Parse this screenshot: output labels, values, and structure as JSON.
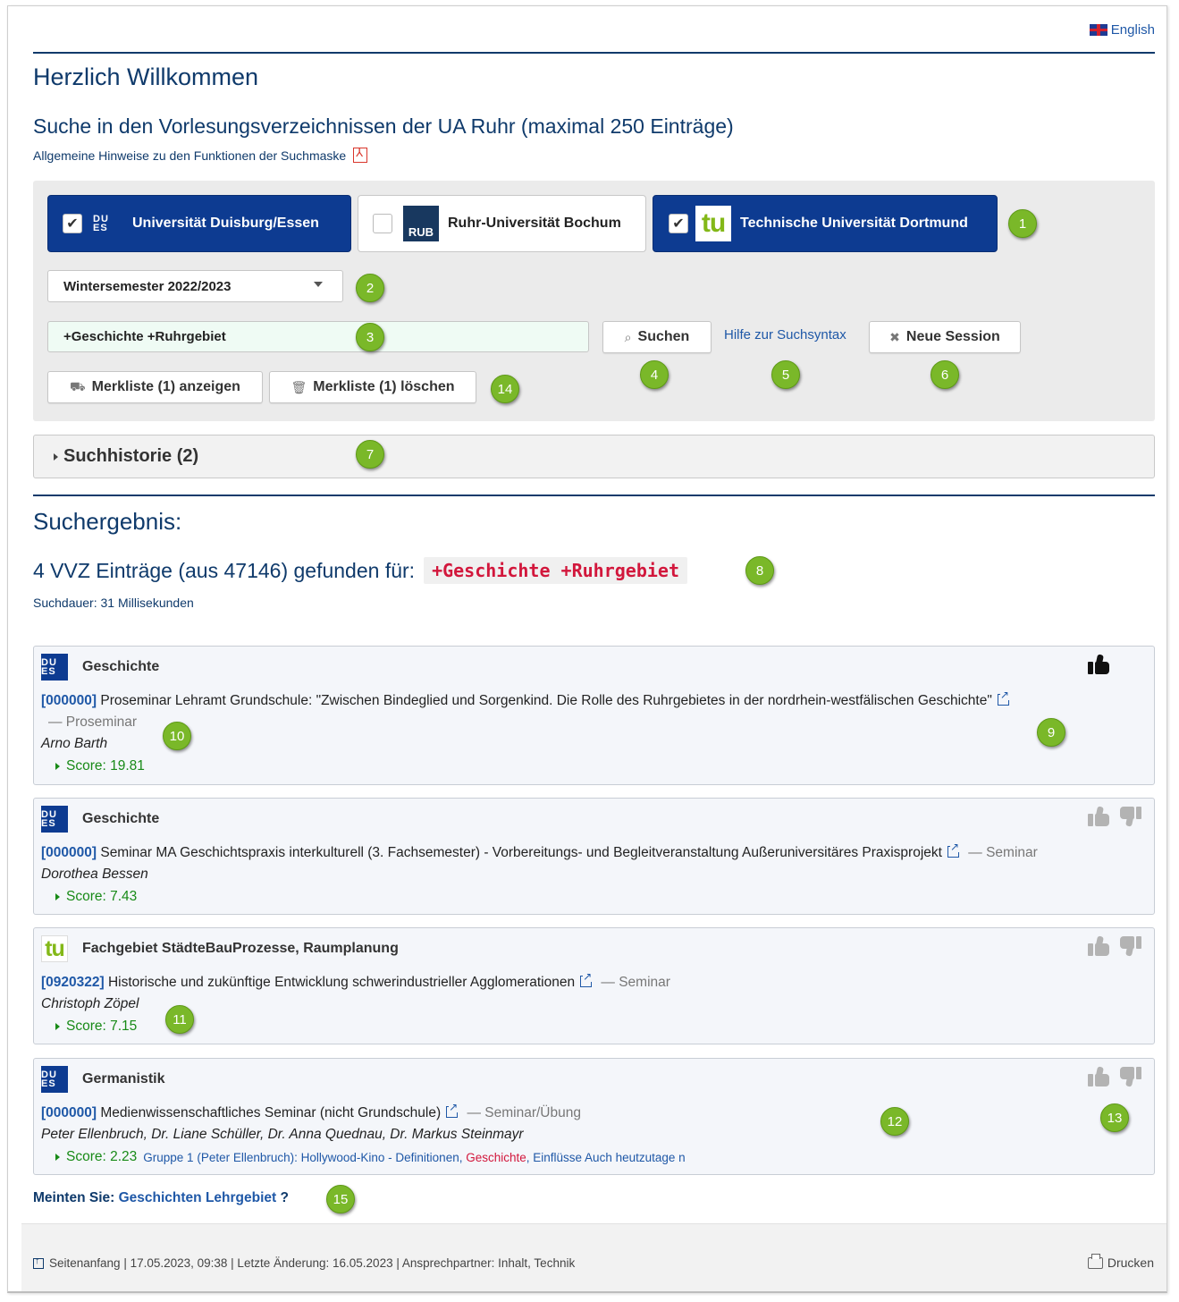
{
  "header": {
    "language_link": "English",
    "welcome": "Herzlich Willkommen",
    "search_title": "Suche in den Vorlesungsverzeichnissen der UA Ruhr (maximal 250 Einträge)",
    "help_pdf_link": "Allgemeine Hinweise zu den Funktionen der Suchmaske"
  },
  "universities": [
    {
      "label": "Universität Duisburg/Essen",
      "checked": true,
      "logo": "DU ES"
    },
    {
      "label": "Ruhr-Universität Bochum",
      "checked": false,
      "logo": "RUB"
    },
    {
      "label": "Technische Universität Dortmund",
      "checked": true,
      "logo": "tu"
    }
  ],
  "search": {
    "semester": "Wintersemester 2022/2023",
    "query": "+Geschichte +Ruhrgebiet",
    "search_button": "Suchen",
    "syntax_help": "Hilfe zur Suchsyntax",
    "new_session_button": "Neue Session",
    "show_list_button": "Merkliste (1) anzeigen",
    "delete_list_button": "Merkliste (1) löschen",
    "checkmark": "✔",
    "search_icon": "⌕",
    "x_icon": "✖",
    "cart_icon": "⛟",
    "trash_icon": "🗑"
  },
  "history": {
    "label": "Suchhistorie (2)"
  },
  "results": {
    "heading": "Suchergebnis:",
    "count_text": "4 VVZ Einträge (aus 47146) gefunden für:",
    "query": "+Geschichte +Ruhrgebiet",
    "duration": "Suchdauer: 31 Millisekunden",
    "items": [
      {
        "dept": "Geschichte",
        "logo": "ude",
        "code": "[000000]",
        "title": " Proseminar Lehramt Grundschule: \"Zwischen Bindeglied und Sorgenkind. Die Rolle des Ruhrgebietes in der nordrhein-westfälischen Geschichte\"",
        "type": "— Proseminar",
        "author": "Arno Barth",
        "score": "Score: 19.81",
        "vote": "liked"
      },
      {
        "dept": "Geschichte",
        "logo": "ude",
        "code": "[000000]",
        "title": " Seminar MA Geschichtspraxis interkulturell (3. Fachsemester) - Vorbereitungs- und Begleitveranstaltung Außeruniversitäres Praxisprojekt",
        "type": "— Seminar",
        "author": "Dorothea Bessen",
        "score": "Score: 7.43",
        "vote": "none"
      },
      {
        "dept": "Fachgebiet StädteBauProzesse, Raumplanung",
        "logo": "tu",
        "code": "[0920322]",
        "title": " Historische und zukünftige Entwicklung schwerindustrieller Agglomerationen",
        "type": "— Seminar",
        "author": "Christoph Zöpel",
        "score": "Score: 7.15",
        "vote": "none"
      },
      {
        "dept": "Germanistik",
        "logo": "ude",
        "code": "[000000]",
        "title": " Medienwissenschaftliches Seminar (nicht Grundschule)",
        "type": "— Seminar/Übung",
        "author": "Peter Ellenbruch, Dr. Liane Schüller, Dr. Anna Quednau, Dr. Markus Steinmayr",
        "score": "Score: 2.23",
        "snippet_a": "Gruppe 1 (Peter Ellenbruch): Hollywood-Kino - Definitionen, ",
        "snippet_hl": "Geschichte",
        "snippet_b": ", Einflüsse Auch heutzutage n",
        "vote": "none"
      }
    ]
  },
  "suggestion": {
    "prefix": "Meinten Sie:",
    "link": "Geschichten Lehrgebiet",
    "suffix": "?"
  },
  "footer": {
    "text": "Seitenanfang | 17.05.2023, 09:38 | Letzte Änderung: 16.05.2023 | Ansprechpartner: Inhalt, Technik",
    "print": "Drucken"
  },
  "badges": [
    "1",
    "2",
    "3",
    "4",
    "5",
    "6",
    "7",
    "8",
    "9",
    "10",
    "11",
    "12",
    "13",
    "14",
    "15"
  ],
  "colors": {
    "primary": "#0d3b91",
    "heading": "#0f3a6b",
    "badge": "#7ab829",
    "score": "#188a17",
    "highlight": "#d2173c"
  }
}
